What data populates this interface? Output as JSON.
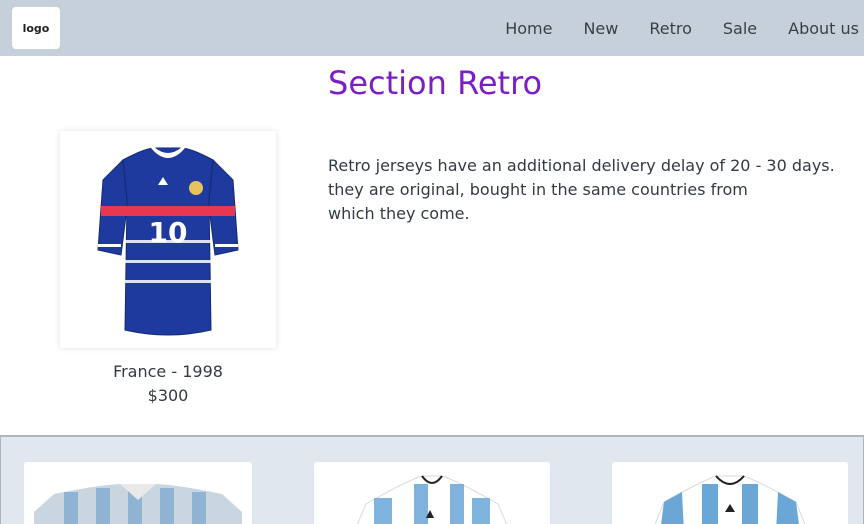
{
  "navbar": {
    "logo_text": "logo",
    "links": [
      "Home",
      "New",
      "Retro",
      "Sale",
      "About us"
    ]
  },
  "section": {
    "title": "Section Retro",
    "description_lines": [
      "Retro jerseys have an additional delivery delay of 20 - 30 days.",
      "they are original, bought in the same countries from",
      "which they come."
    ]
  },
  "featured_product": {
    "name": "France - 1998",
    "price": "$300",
    "jersey_number": "10",
    "colors": {
      "shirt": "#1e3a9e",
      "stripe": "#e8384f",
      "collar": "#ffffff"
    }
  },
  "more_products": [
    {
      "image": "argentina-retro-jersey"
    },
    {
      "image": "argentina-jersey-adidas"
    },
    {
      "image": "argentina-jersey-adidas-2006"
    }
  ],
  "colors": {
    "accent": "#7b1fc4",
    "navbar": "#c5d0db",
    "strip": "#e1e7ef"
  }
}
